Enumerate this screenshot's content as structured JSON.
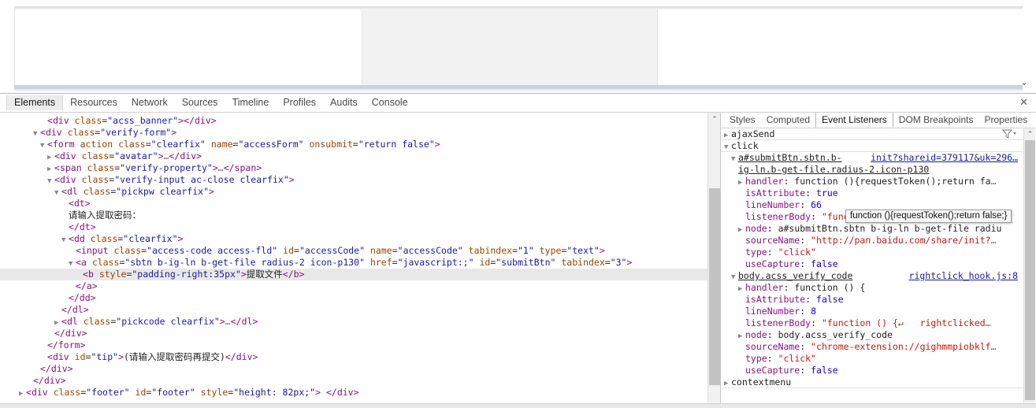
{
  "page": {
    "password_label": "请输入提取密码：",
    "password_value": "",
    "password_placeholder": "",
    "submit_label": "提取文件",
    "submit_color": "#0a84e4",
    "scroll_arrow": "⌄"
  },
  "devtools": {
    "tabs": [
      {
        "label": "Elements",
        "active": true
      },
      {
        "label": "Resources",
        "active": false
      },
      {
        "label": "Network",
        "active": false
      },
      {
        "label": "Sources",
        "active": false
      },
      {
        "label": "Timeline",
        "active": false
      },
      {
        "label": "Profiles",
        "active": false
      },
      {
        "label": "Audits",
        "active": false
      },
      {
        "label": "Console",
        "active": false
      }
    ],
    "close_label": "✕",
    "dom_rows": [
      {
        "indent": 6,
        "twisty": "",
        "html": "<span class=\"punc\">&lt;</span><span class=\"tag\">div</span> <span class=\"attr\">class</span>=<span class=\"val\">\"acss_banner\"</span><span class=\"punc\">&gt;&lt;/</span><span class=\"tag\">div</span><span class=\"punc\">&gt;</span>"
      },
      {
        "indent": 5,
        "twisty": "▼",
        "html": "<span class=\"punc\">&lt;</span><span class=\"tag\">div</span> <span class=\"attr\">class</span>=<span class=\"val\">\"verify-form\"</span><span class=\"punc\">&gt;</span>"
      },
      {
        "indent": 6,
        "twisty": "▼",
        "html": "<span class=\"punc\">&lt;</span><span class=\"tag\">form</span> <span class=\"attr\">action</span> <span class=\"attr\">class</span>=<span class=\"val\">\"clearfix\"</span> <span class=\"attr\">name</span>=<span class=\"val\">\"accessForm\"</span> <span class=\"attr\">onsubmit</span>=<span class=\"val\">\"return false\"</span><span class=\"punc\">&gt;</span>"
      },
      {
        "indent": 7,
        "twisty": "▶",
        "html": "<span class=\"punc\">&lt;</span><span class=\"tag\">div</span> <span class=\"attr\">class</span>=<span class=\"val\">\"avatar\"</span><span class=\"punc\">&gt;</span><span class=\"ellip\">…</span><span class=\"punc\">&lt;/</span><span class=\"tag\">div</span><span class=\"punc\">&gt;</span>"
      },
      {
        "indent": 7,
        "twisty": "▶",
        "html": "<span class=\"punc\">&lt;</span><span class=\"tag\">span</span> <span class=\"attr\">class</span>=<span class=\"val\">\"verify-property\"</span><span class=\"punc\">&gt;</span><span class=\"ellip\">…</span><span class=\"punc\">&lt;/</span><span class=\"tag\">span</span><span class=\"punc\">&gt;</span>"
      },
      {
        "indent": 7,
        "twisty": "▼",
        "html": "<span class=\"punc\">&lt;</span><span class=\"tag\">div</span> <span class=\"attr\">class</span>=<span class=\"val\">\"verify-input ac-close clearfix\"</span><span class=\"punc\">&gt;</span>"
      },
      {
        "indent": 8,
        "twisty": "▼",
        "html": "<span class=\"punc\">&lt;</span><span class=\"tag\">dl</span> <span class=\"attr\">class</span>=<span class=\"val\">\"pickpw clearfix\"</span><span class=\"punc\">&gt;</span>"
      },
      {
        "indent": 9,
        "twisty": "",
        "html": "<span class=\"punc\">&lt;</span><span class=\"tag\">dt</span><span class=\"punc\">&gt;</span>"
      },
      {
        "indent": 9,
        "twisty": "",
        "html": "<span class=\"txt\">请输入提取密码：</span>"
      },
      {
        "indent": 9,
        "twisty": "",
        "html": "<span class=\"punc\">&lt;/</span><span class=\"tag\">dt</span><span class=\"punc\">&gt;</span>"
      },
      {
        "indent": 9,
        "twisty": "▼",
        "html": "<span class=\"punc\">&lt;</span><span class=\"tag\">dd</span> <span class=\"attr\">class</span>=<span class=\"val\">\"clearfix\"</span><span class=\"punc\">&gt;</span>"
      },
      {
        "indent": 10,
        "twisty": "",
        "html": "<span class=\"punc\">&lt;</span><span class=\"tag\">input</span> <span class=\"attr\">class</span>=<span class=\"val\">\"access-code access-fld\"</span> <span class=\"attr\">id</span>=<span class=\"val\">\"accessCode\"</span> <span class=\"attr\">name</span>=<span class=\"val\">\"accessCode\"</span> <span class=\"attr\">tabindex</span>=<span class=\"val\">\"1\"</span> <span class=\"attr\">type</span>=<span class=\"val\">\"text\"</span><span class=\"punc\">&gt;</span>"
      },
      {
        "indent": 10,
        "twisty": "▼",
        "html": "<span class=\"punc\">&lt;</span><span class=\"tag\">a</span> <span class=\"attr\">class</span>=<span class=\"val\">\"sbtn b-ig-ln b-get-file radius-2 icon-p130\"</span> <span class=\"attr\">href</span>=<span class=\"val\">\"javascript:;\"</span> <span class=\"attr\">id</span>=<span class=\"val\">\"submitBtn\"</span> <span class=\"attr\">tabindex</span>=<span class=\"val\">\"3\"</span><span class=\"punc\">&gt;</span>"
      },
      {
        "indent": 11,
        "twisty": "",
        "selected": true,
        "html": "<span class=\"punc\">&lt;</span><span class=\"tag\">b</span> <span class=\"attr\">style</span>=<span class=\"val\">\"padding-right:35px\"</span><span class=\"punc\">&gt;</span><span class=\"txt\">提取文件</span><span class=\"punc\">&lt;/</span><span class=\"tag\">b</span><span class=\"punc\">&gt;</span>"
      },
      {
        "indent": 10,
        "twisty": "",
        "html": "<span class=\"punc\">&lt;/</span><span class=\"tag\">a</span><span class=\"punc\">&gt;</span>"
      },
      {
        "indent": 9,
        "twisty": "",
        "html": "<span class=\"punc\">&lt;/</span><span class=\"tag\">dd</span><span class=\"punc\">&gt;</span>"
      },
      {
        "indent": 8,
        "twisty": "",
        "html": "<span class=\"punc\">&lt;/</span><span class=\"tag\">dl</span><span class=\"punc\">&gt;</span>"
      },
      {
        "indent": 8,
        "twisty": "▶",
        "html": "<span class=\"punc\">&lt;</span><span class=\"tag\">dl</span> <span class=\"attr\">class</span>=<span class=\"val\">\"pickcode clearfix\"</span><span class=\"punc\">&gt;</span><span class=\"ellip\">…</span><span class=\"punc\">&lt;/</span><span class=\"tag\">dl</span><span class=\"punc\">&gt;</span>"
      },
      {
        "indent": 7,
        "twisty": "",
        "html": "<span class=\"punc\">&lt;/</span><span class=\"tag\">div</span><span class=\"punc\">&gt;</span>"
      },
      {
        "indent": 6,
        "twisty": "",
        "html": "<span class=\"punc\">&lt;/</span><span class=\"tag\">form</span><span class=\"punc\">&gt;</span>"
      },
      {
        "indent": 6,
        "twisty": "",
        "html": "<span class=\"punc\">&lt;</span><span class=\"tag\">div</span> <span class=\"attr\">id</span>=<span class=\"val\">\"tip\"</span><span class=\"punc\">&gt;</span><span class=\"txt\">(请输入提取密码再提交)</span><span class=\"punc\">&lt;/</span><span class=\"tag\">div</span><span class=\"punc\">&gt;</span>"
      },
      {
        "indent": 5,
        "twisty": "",
        "html": "<span class=\"punc\">&lt;/</span><span class=\"tag\">div</span><span class=\"punc\">&gt;</span>"
      },
      {
        "indent": 4,
        "twisty": "",
        "html": "<span class=\"punc\">&lt;/</span><span class=\"tag\">div</span><span class=\"punc\">&gt;</span>"
      },
      {
        "indent": 3,
        "twisty": "▶",
        "html": "<span class=\"punc\">&lt;</span><span class=\"tag\">div</span> <span class=\"attr\">class</span>=<span class=\"val\">\"footer\"</span> <span class=\"attr\">id</span>=<span class=\"val\">\"footer\"</span> <span class=\"attr\">style</span>=<span class=\"val\">\"height: 82px;\"</span><span class=\"punc\">&gt;</span> <span class=\"punc\">&lt;/</span><span class=\"tag\">div</span><span class=\"punc\">&gt;</span>"
      }
    ],
    "sidebar_tabs": [
      {
        "label": "Styles",
        "active": false
      },
      {
        "label": "Computed",
        "active": false
      },
      {
        "label": "Event Listeners",
        "active": true
      },
      {
        "label": "DOM Breakpoints",
        "active": false
      },
      {
        "label": "Properties",
        "active": false
      }
    ],
    "event_rows": [
      {
        "indent": 0,
        "twisty": "▶",
        "html": "<span class=\"ev-name\">ajaxSend</span>",
        "filter": true,
        "sep": true
      },
      {
        "indent": 0,
        "twisty": "▼",
        "html": "<span class=\"ev-name\">click</span>",
        "sep": true
      },
      {
        "indent": 1,
        "twisty": "▼",
        "html": "<span class=\"ev-sel\">a#submitBtn.sbtn.b-</span>",
        "right": "init?shareid=379117&uk=296…"
      },
      {
        "indent": 1,
        "twisty": "",
        "html": "<span class=\"ev-sel\">ig-ln.b-get-file.radius-2.icon-p130</span>",
        "nogap": true
      },
      {
        "indent": 2,
        "twisty": "▶",
        "html": "<span class=\"ev-key\">handler</span><span class=\"ev-plain\">: function (){requestToken();return fa</span><span class=\"ellip\">…</span>"
      },
      {
        "indent": 2,
        "twisty": "",
        "html": "<span class=\"ev-key\">isAttribute</span><span class=\"ev-plain\">: </span><span class=\"ev-bool\">true</span>"
      },
      {
        "indent": 2,
        "twisty": "",
        "html": "<span class=\"ev-key\">lineNumber</span><span class=\"ev-plain\">: </span><span class=\"ev-num\">66</span>"
      },
      {
        "indent": 2,
        "twisty": "",
        "html": "<span class=\"ev-key\">listenerBody</span><span class=\"ev-plain\">: </span><span class=\"ev-str\">\"function (){requestToken();ret</span><span class=\"ellip\">…</span>"
      },
      {
        "indent": 2,
        "twisty": "▶",
        "html": "<span class=\"ev-key\">node</span><span class=\"ev-plain\">: </span><span class=\"ev-node\">a#submitBtn.sbtn b-ig-ln b-get-file radiu</span>"
      },
      {
        "indent": 2,
        "twisty": "",
        "html": "<span class=\"ev-key\">sourceName</span><span class=\"ev-plain\">: </span><span class=\"ev-str\">\"http://pan.baidu.com/share/init?</span><span class=\"ellip\">…</span>"
      },
      {
        "indent": 2,
        "twisty": "",
        "html": "<span class=\"ev-key\">type</span><span class=\"ev-plain\">: </span><span class=\"ev-str\">\"click\"</span>"
      },
      {
        "indent": 2,
        "twisty": "",
        "html": "<span class=\"ev-key\">useCapture</span><span class=\"ev-plain\">: </span><span class=\"ev-bool\">false</span>"
      },
      {
        "indent": 1,
        "twisty": "▼",
        "html": "<span class=\"ev-sel\">body.acss_verify_code</span>",
        "right": "rightclick_hook.js:8",
        "rightlink": true
      },
      {
        "indent": 2,
        "twisty": "▶",
        "html": "<span class=\"ev-key\">handler</span><span class=\"ev-plain\">: function () {</span>"
      },
      {
        "indent": 2,
        "twisty": "",
        "html": "<span class=\"ev-key\">isAttribute</span><span class=\"ev-plain\">: </span><span class=\"ev-bool\">false</span>"
      },
      {
        "indent": 2,
        "twisty": "",
        "html": "<span class=\"ev-key\">lineNumber</span><span class=\"ev-plain\">: </span><span class=\"ev-num\">8</span>"
      },
      {
        "indent": 2,
        "twisty": "",
        "html": "<span class=\"ev-key\">listenerBody</span><span class=\"ev-plain\">: </span><span class=\"ev-str\">\"function () {↵   rightclicked</span><span class=\"ellip\">…</span>"
      },
      {
        "indent": 2,
        "twisty": "▶",
        "html": "<span class=\"ev-key\">node</span><span class=\"ev-plain\">: </span><span class=\"ev-node\">body.acss_verify_code</span>"
      },
      {
        "indent": 2,
        "twisty": "",
        "html": "<span class=\"ev-key\">sourceName</span><span class=\"ev-plain\">: </span><span class=\"ev-str\">\"chrome-extension://gighmmpiobklf</span><span class=\"ellip\">…</span>"
      },
      {
        "indent": 2,
        "twisty": "",
        "html": "<span class=\"ev-key\">type</span><span class=\"ev-plain\">: </span><span class=\"ev-str\">\"click\"</span>"
      },
      {
        "indent": 2,
        "twisty": "",
        "html": "<span class=\"ev-key\">useCapture</span><span class=\"ev-plain\">: </span><span class=\"ev-bool\">false</span>"
      },
      {
        "indent": 0,
        "twisty": "▶",
        "html": "<span class=\"ev-name\">contextmenu</span>",
        "sep": true
      }
    ],
    "tooltip_text": "function (){requestToken();return false;}"
  }
}
